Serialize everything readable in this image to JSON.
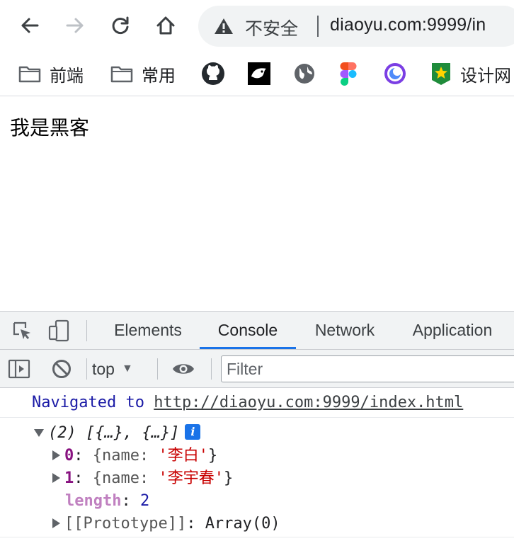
{
  "browser": {
    "security_label": "不安全",
    "url": "diaoyu.com:9999/in"
  },
  "bookmarks": {
    "items": [
      {
        "label": "前端",
        "icon": "folder-icon"
      },
      {
        "label": "常用",
        "icon": "folder-icon"
      },
      {
        "label": "",
        "icon": "github-icon"
      },
      {
        "label": "",
        "icon": "panther-icon"
      },
      {
        "label": "",
        "icon": "globe-icon"
      },
      {
        "label": "",
        "icon": "figma-icon"
      },
      {
        "label": "",
        "icon": "swirl-icon"
      },
      {
        "label": "设计网",
        "icon": "star-badge-icon"
      }
    ]
  },
  "page": {
    "text": "我是黑客"
  },
  "devtools": {
    "tabs": [
      "Elements",
      "Console",
      "Network",
      "Application"
    ],
    "active_tab": "Console",
    "context": "top",
    "filter_placeholder": "Filter",
    "accent_color": "#1a73e8"
  },
  "console": {
    "navigated_prefix": "Navigated to",
    "navigated_url": "http://diaoyu.com:9999/index.html",
    "array_summary": "(2) [{…}, {…}]",
    "info_badge": "i",
    "items": [
      {
        "index": "0",
        "open": "{name: ",
        "value": "'李白'",
        "close": "}"
      },
      {
        "index": "1",
        "open": "{name: ",
        "value": "'李宇春'",
        "close": "}"
      }
    ],
    "length_key": "length",
    "length_value": "2",
    "prototype_key": "[[Prototype]]",
    "prototype_value": "Array(0)"
  }
}
